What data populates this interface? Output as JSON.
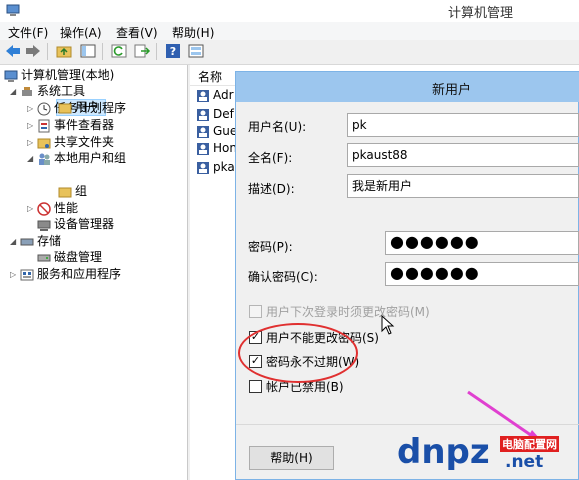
{
  "window": {
    "title": "计算机管理"
  },
  "menu": [
    "文件(F)",
    "操作(A)",
    "查看(V)",
    "帮助(H)"
  ],
  "toolbar": {
    "buttons": [
      "back-icon",
      "forward-icon",
      "up-folder-icon",
      "show-hide-tree-icon",
      "refresh-icon",
      "export-icon",
      "help-icon",
      "properties-icon"
    ]
  },
  "tree": {
    "root": "计算机管理(本地)",
    "system_tools": "系统工具",
    "task_scheduler": "任务计划程序",
    "event_viewer": "事件查看器",
    "shared_folders": "共享文件夹",
    "local_users_groups": "本地用户和组",
    "users": "用户",
    "groups": "组",
    "performance": "性能",
    "device_manager": "设备管理器",
    "storage": "存储",
    "disk_management": "磁盘管理",
    "services_apps": "服务和应用程序"
  },
  "list": {
    "column_name": "名称",
    "rows": [
      "Adr",
      "Def",
      "Gue",
      "Hon",
      "pka"
    ]
  },
  "dialog": {
    "title": "新用户",
    "username_label": "用户名(U):",
    "username_value": "pk",
    "fullname_label": "全名(F):",
    "fullname_value": "pkaust88",
    "description_label": "描述(D):",
    "description_value": "我是新用户",
    "password_label": "密码(P):",
    "password_value": "●●●●●●",
    "confirm_label": "确认密码(C):",
    "confirm_value": "●●●●●●",
    "cb_must_change": "用户下次登录时须更改密码(M)",
    "cb_cannot_change": "用户不能更改密码(S)",
    "cb_never_expires": "密码永不过期(W)",
    "cb_disabled": "帐户已禁用(B)",
    "help_button": "帮助(H)"
  },
  "checkbox_states": {
    "must_change": false,
    "cannot_change": true,
    "never_expires": true,
    "disabled": false
  },
  "watermark": {
    "brand_main": "dnpz",
    "brand_suffix": ".net",
    "brand_cn": "电脑配置网"
  },
  "colors": {
    "dialog_title_bg": "#9cc6ee",
    "selection": "#cde8ff",
    "annotation_circle": "#e03030",
    "annotation_arrow": "#e040d0",
    "watermark_blue": "#1a4fa8"
  }
}
